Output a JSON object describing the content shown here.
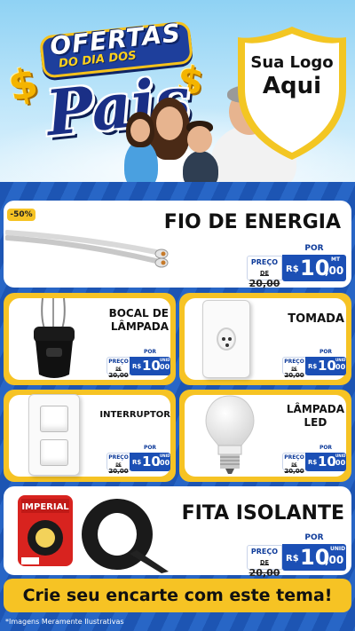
{
  "header": {
    "title_top": "OFERTAS",
    "title_middle": "DO DIA DOS",
    "title_main": "Pais",
    "dollar_sign": "$",
    "logo_line1": "Sua Logo",
    "logo_line2": "Aqui"
  },
  "products": [
    {
      "name": "FIO DE ENERGIA",
      "badge": "-50%",
      "preco_label": "PREÇO",
      "old_prefix": "DE",
      "old_price": "20,00",
      "por_label": "POR",
      "currency": "R$",
      "price_int": "10",
      "price_dec": ",00",
      "unit": "MT"
    },
    {
      "name_line1": "BOCAL DE",
      "name_line2": "LÂMPADA",
      "preco_label": "PREÇO",
      "old_prefix": "DE",
      "old_price": "20,00",
      "por_label": "POR",
      "currency": "R$",
      "price_int": "10",
      "price_dec": ",00",
      "unit": "UNID"
    },
    {
      "name": "TOMADA",
      "preco_label": "PREÇO",
      "old_prefix": "DE",
      "old_price": "20,00",
      "por_label": "POR",
      "currency": "R$",
      "price_int": "10",
      "price_dec": ",00",
      "unit": "UNID"
    },
    {
      "name": "INTERRUPTOR",
      "preco_label": "PREÇO",
      "old_prefix": "DE",
      "old_price": "20,00",
      "por_label": "POR",
      "currency": "R$",
      "price_int": "10",
      "price_dec": ",00",
      "unit": "UNID"
    },
    {
      "name_line1": "LÂMPADA",
      "name_line2": "LED",
      "preco_label": "PREÇO",
      "old_prefix": "DE",
      "old_price": "20,00",
      "por_label": "POR",
      "currency": "R$",
      "price_int": "10",
      "price_dec": ",00",
      "unit": "UNID"
    },
    {
      "name": "FITA ISOLANTE",
      "brand": "IMPERIAL",
      "preco_label": "PREÇO",
      "old_prefix": "DE",
      "old_price": "20,00",
      "por_label": "POR",
      "currency": "R$",
      "price_int": "10",
      "price_dec": ",00",
      "unit": "UNID"
    }
  ],
  "footer": {
    "cta": "Crie seu encarte com este tema!",
    "disclaimer": "*Imagens Meramente Ilustrativas"
  },
  "colors": {
    "background_blue": "#1b4fa8",
    "accent_yellow": "#f6c324",
    "price_blue": "#1b4fb5"
  }
}
